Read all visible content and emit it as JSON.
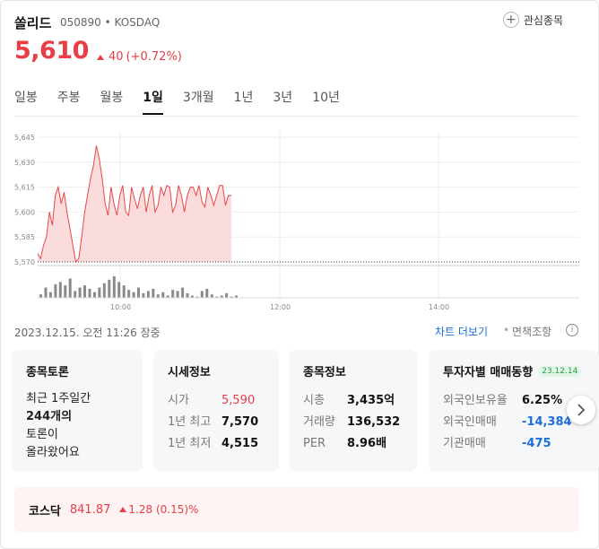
{
  "stock": {
    "name": "쏠리드",
    "code_market": "050890 • KOSDAQ",
    "price": "5,610",
    "change": "40",
    "change_pct": "(+0.72%)",
    "favorite_label": "관심종목"
  },
  "tabs": [
    "일봉",
    "주봉",
    "월봉",
    "1일",
    "3개월",
    "1년",
    "3년",
    "10년"
  ],
  "active_tab": "1일",
  "chart_data": {
    "type": "area",
    "title": "",
    "xlabel": "",
    "ylabel": "",
    "x_ticks": [
      "10:00",
      "12:00",
      "14:00"
    ],
    "y_ticks": [
      "5,570",
      "5,585",
      "5,600",
      "5,615",
      "5,630",
      "5,645"
    ],
    "ylim": [
      5570,
      5645
    ],
    "previous_close": 5570,
    "price_series": [
      5575,
      5572,
      5580,
      5585,
      5600,
      5592,
      5610,
      5615,
      5605,
      5612,
      5600,
      5590,
      5580,
      5570,
      5572,
      5585,
      5600,
      5610,
      5620,
      5628,
      5640,
      5632,
      5620,
      5605,
      5598,
      5615,
      5605,
      5598,
      5610,
      5616,
      5600,
      5598,
      5615,
      5608,
      5602,
      5610,
      5615,
      5600,
      5610,
      5616,
      5600,
      5604,
      5615,
      5610,
      5616,
      5615,
      5600,
      5604,
      5616,
      5610,
      5600,
      5610,
      5615,
      5615,
      5610,
      5616,
      5606,
      5603,
      5615,
      5610,
      5604,
      5610,
      5616,
      5616,
      5604,
      5610,
      5610
    ],
    "volume_series": [
      3,
      9,
      5,
      12,
      14,
      11,
      17,
      6,
      9,
      11,
      8,
      5,
      9,
      13,
      16,
      19,
      14,
      11,
      7,
      5,
      9,
      4,
      6,
      8,
      3,
      5,
      2,
      7,
      6,
      9,
      4,
      2,
      1,
      6,
      8,
      3,
      1,
      2,
      4,
      1,
      2
    ],
    "grid": true,
    "colors": {
      "line": "#e84747",
      "fill": "#fbdcdc",
      "volume": "#8a8a8a"
    }
  },
  "timestamp": "2023.12.15. 오전 11:26 장중",
  "more_chart": "차트 더보기",
  "separator_dot": "•",
  "disclaimer": "면책조항",
  "info_icon": "i",
  "discussion": {
    "title": "종목토론",
    "lines": [
      "최근 1주일간",
      "244개의",
      "토론이",
      "올라왔어요"
    ]
  },
  "market_info": {
    "title": "시세정보",
    "rows": [
      {
        "label": "시가",
        "value": "5,590"
      },
      {
        "label": "1년 최고",
        "value": "7,570"
      },
      {
        "label": "1년 최저",
        "value": "4,515"
      }
    ]
  },
  "stock_info": {
    "title": "종목정보",
    "rows": [
      {
        "label": "시총",
        "value": "3,435억"
      },
      {
        "label": "거래량",
        "value": "136,532"
      },
      {
        "label": "PER",
        "value": "8.96배"
      }
    ]
  },
  "investor": {
    "title": "투자자별 매매동향",
    "date": "23.12.14",
    "rows": [
      {
        "label": "외국인보유율",
        "value": "6.25%"
      },
      {
        "label": "외국인매매",
        "value": "-14,384"
      },
      {
        "label": "기관매매",
        "value": "-475"
      }
    ]
  },
  "index": {
    "name": "코스닥",
    "value": "841.87",
    "change": "1.28",
    "change_pct": "(0.15)%"
  }
}
